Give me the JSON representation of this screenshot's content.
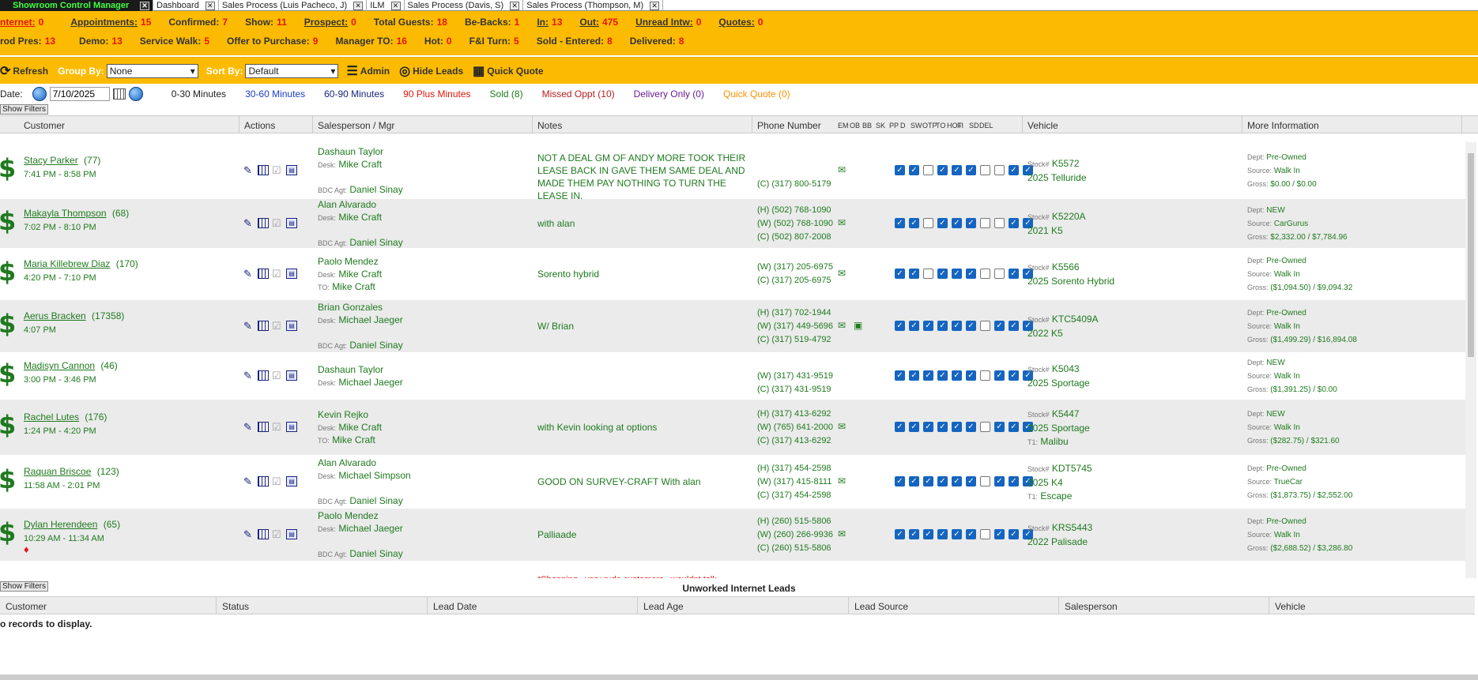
{
  "tabs": [
    {
      "label": "Showroom Control Manager",
      "active": true
    },
    {
      "label": "Dashboard"
    },
    {
      "label": "Sales Process (Luis Pacheco, J)"
    },
    {
      "label": "ILM"
    },
    {
      "label": "Sales Process (Davis, S)"
    },
    {
      "label": "Sales Process (Thompson, M)"
    }
  ],
  "stats_row1": [
    {
      "label": "nternet:",
      "value": "0",
      "underline": true,
      "red": true
    },
    {
      "label": "Appointments:",
      "value": "15",
      "underline": true
    },
    {
      "label": "Confirmed:",
      "value": "7"
    },
    {
      "label": "Show:",
      "value": "11"
    },
    {
      "label": "Prospect:",
      "value": "0",
      "underline": true
    },
    {
      "label": "Total Guests:",
      "value": "18"
    },
    {
      "label": "Be-Backs:",
      "value": "1"
    },
    {
      "label": "In:",
      "value": "13",
      "underline": true
    },
    {
      "label": "Out:",
      "value": "475",
      "underline": true
    },
    {
      "label": "Unread Intw:",
      "value": "0",
      "underline": true
    },
    {
      "label": "Quotes:",
      "value": "0",
      "underline": true
    }
  ],
  "stats_row2": [
    {
      "label": "rod Pres:",
      "value": "13"
    },
    {
      "label": "Demo:",
      "value": "13"
    },
    {
      "label": "Service Walk:",
      "value": "5"
    },
    {
      "label": "Offer to Purchase:",
      "value": "9"
    },
    {
      "label": "Manager TO:",
      "value": "16"
    },
    {
      "label": "Hot:",
      "value": "0"
    },
    {
      "label": "F&I Turn:",
      "value": "5"
    },
    {
      "label": "Sold - Entered:",
      "value": "8"
    },
    {
      "label": "Delivered:",
      "value": "8"
    }
  ],
  "toolbar": {
    "refresh": "Refresh",
    "group_by_label": "Group By:",
    "group_by_value": "None",
    "sort_by_label": "Sort By:",
    "sort_by_value": "Default",
    "admin": "Admin",
    "hide_leads": "Hide Leads",
    "quick_quote": "Quick Quote"
  },
  "daterow": {
    "date_label": "Date:",
    "date_value": "7/10/2025",
    "legend": [
      {
        "label": "0-30 Minutes",
        "color": "#222222"
      },
      {
        "label": "30-60 Minutes",
        "color": "#1a3cc8"
      },
      {
        "label": "60-90 Minutes",
        "color": "#1a237e"
      },
      {
        "label": "90 Plus Minutes",
        "color": "#e8140b"
      },
      {
        "label": "Sold (8)",
        "color": "#1f7a1f"
      },
      {
        "label": "Missed Oppt (10)",
        "color": "#b71c1c"
      },
      {
        "label": "Delivery Only (0)",
        "color": "#6a1b9a"
      },
      {
        "label": "Quick Quote (0)",
        "color": "#ff8f00"
      }
    ]
  },
  "show_filters": "Show Filters",
  "columns": {
    "customer": "Customer",
    "actions": "Actions",
    "salesperson": "Salesperson / Mgr",
    "notes": "Notes",
    "phone": "Phone Number",
    "flags": [
      "EM",
      "OB",
      "BB",
      "SK",
      "PP",
      "D",
      "SW",
      "OTP",
      "TO",
      "HOT",
      "FI",
      "SD",
      "DEL"
    ],
    "vehicle": "Vehicle",
    "more_info": "More Information"
  },
  "rows": [
    {
      "name": "Stacy Parker",
      "count": "(77)",
      "time": "7:41 PM - 8:58 PM",
      "sp": [
        [
          "",
          "Dashaun Taylor"
        ],
        [
          "Desk:",
          "Mike Craft"
        ],
        [
          "",
          ""
        ],
        [
          "BDC Agt:",
          "Daniel Sinay"
        ]
      ],
      "notes": "NOT A DEAL GM OF ANDY MORE TOOK THEIR LEASE BACK IN GAVE THEM SAME DEAL AND MADE THEM PAY NOTHING TO TURN THE LEASE IN.",
      "phones": [
        "",
        "",
        "(C) (317) 800-5179"
      ],
      "email": true,
      "car": false,
      "checks": [
        1,
        1,
        0,
        1,
        1,
        1,
        0,
        0,
        1,
        1
      ],
      "stock": "K5572",
      "vehicle": "2025 Telluride",
      "trade": "",
      "dept": "Pre-Owned",
      "source": "Walk In",
      "gross": "$0.00 / $0.00"
    },
    {
      "name": "Makayla Thompson",
      "count": "(68)",
      "time": "7:02 PM - 8:10 PM",
      "sp": [
        [
          "",
          "Alan Alvarado"
        ],
        [
          "Desk:",
          "Mike Craft"
        ],
        [
          "",
          ""
        ],
        [
          "BDC Agt:",
          "Daniel Sinay"
        ]
      ],
      "notes": "with alan",
      "phones": [
        "(H) (502) 768-1090",
        "(W) (502) 768-1090",
        "(C) (502) 807-2008"
      ],
      "email": true,
      "car": false,
      "checks": [
        1,
        1,
        0,
        1,
        1,
        1,
        0,
        0,
        1,
        1
      ],
      "stock": "K5220A",
      "vehicle": "2021 K5",
      "trade": "",
      "dept": "NEW",
      "source": "CarGurus",
      "gross": "$2,332.00 / $7,784.96"
    },
    {
      "name": "Maria Killebrew Diaz",
      "count": "(170)",
      "time": "4:20 PM - 7:10 PM",
      "sp": [
        [
          "",
          "Paolo Mendez"
        ],
        [
          "Desk:",
          "Mike Craft"
        ],
        [
          "TO:",
          "Mike Craft"
        ]
      ],
      "notes": "Sorento hybrid",
      "phones": [
        "(W) (317) 205-6975",
        "(C) (317) 205-6975"
      ],
      "email": true,
      "car": false,
      "checks": [
        1,
        1,
        0,
        1,
        1,
        1,
        0,
        0,
        1,
        1
      ],
      "stock": "K5566",
      "vehicle": "2025 Sorento Hybrid",
      "trade": "",
      "dept": "Pre-Owned",
      "source": "Walk In",
      "gross": "($1,094.50) / $9,094.32"
    },
    {
      "name": "Aerus Bracken",
      "count": "(17358)",
      "time": "4:07 PM",
      "sp": [
        [
          "",
          "Brian Gonzales"
        ],
        [
          "Desk:",
          "Michael Jaeger"
        ],
        [
          "",
          ""
        ],
        [
          "BDC Agt:",
          "Daniel Sinay"
        ]
      ],
      "notes": "W/ Brian",
      "phones": [
        "(H) (317) 702-1944",
        "(W) (317) 449-5696",
        "(C) (317) 519-4792"
      ],
      "email": true,
      "car": true,
      "checks": [
        1,
        1,
        1,
        1,
        1,
        1,
        0,
        1,
        1,
        1
      ],
      "stock": "KTC5409A",
      "vehicle": "2022 K5",
      "trade": "",
      "dept": "Pre-Owned",
      "source": "Walk In",
      "gross": "($1,499.29) / $16,894.08"
    },
    {
      "name": "Madisyn Cannon",
      "count": "(46)",
      "time": "3:00 PM - 3:46 PM",
      "sp": [
        [
          "",
          "Dashaun Taylor"
        ],
        [
          "Desk:",
          "Michael Jaeger"
        ]
      ],
      "notes": "",
      "phones": [
        "",
        "(W) (317) 431-9519",
        "(C) (317) 431-9519"
      ],
      "email": false,
      "car": false,
      "checks": [
        1,
        1,
        1,
        1,
        1,
        1,
        0,
        1,
        1,
        1
      ],
      "stock": "K5043",
      "vehicle": "2025 Sportage",
      "trade": "",
      "dept": "NEW",
      "source": "Walk In",
      "gross": "($1,391.25) / $0.00"
    },
    {
      "name": "Rachel Lutes",
      "count": "(176)",
      "time": "1:24 PM - 4:20 PM",
      "sp": [
        [
          "",
          "Kevin Rejko"
        ],
        [
          "Desk:",
          "Mike Craft"
        ],
        [
          "TO:",
          "Mike Craft"
        ]
      ],
      "notes": "with Kevin looking at options",
      "phones": [
        "(H) (317) 413-6292",
        "(W) (765) 641-2000",
        "(C) (317) 413-6292"
      ],
      "email": true,
      "car": false,
      "checks": [
        1,
        1,
        1,
        1,
        1,
        1,
        0,
        1,
        1,
        1
      ],
      "stock": "K5447",
      "vehicle": "2025 Sportage",
      "trade": "Malibu",
      "dept": "NEW",
      "source": "Walk In",
      "gross": "($282.75) / $321.60"
    },
    {
      "name": "Raquan Briscoe",
      "count": "(123)",
      "time": "11:58 AM - 2:01 PM",
      "sp": [
        [
          "",
          "Alan Alvarado"
        ],
        [
          "Desk:",
          "Michael Simpson"
        ],
        [
          "",
          ""
        ],
        [
          "BDC Agt:",
          "Daniel Sinay"
        ]
      ],
      "notes": "GOOD ON SURVEY-CRAFT With alan",
      "phones": [
        "(H) (317) 454-2598",
        "(W) (317) 415-8111",
        "(C) (317) 454-2598"
      ],
      "email": true,
      "car": false,
      "checks": [
        1,
        1,
        1,
        1,
        1,
        1,
        0,
        1,
        1,
        1
      ],
      "stock": "KDT5745",
      "vehicle": "2025 K4",
      "trade": "Escape",
      "dept": "Pre-Owned",
      "source": "TrueCar",
      "gross": "($1,873.75) / $2,552.00"
    },
    {
      "name": "Dylan Herendeen",
      "count": "(65)",
      "time": "10:29 AM - 11:34 AM",
      "sp": [
        [
          "",
          "Paolo Mendez"
        ],
        [
          "Desk:",
          "Michael Jaeger"
        ],
        [
          "",
          ""
        ],
        [
          "BDC Agt:",
          "Daniel Sinay"
        ]
      ],
      "notes": "Palliaade",
      "phones": [
        "(H) (260) 515-5806",
        "(W) (260) 266-9936",
        "(C) (260) 515-5806"
      ],
      "email": true,
      "car": false,
      "checks": [
        1,
        1,
        1,
        1,
        1,
        1,
        0,
        1,
        1,
        1
      ],
      "stock": "KRS5443",
      "vehicle": "2022 Palisade",
      "trade": "",
      "dept": "Pre-Owned",
      "source": "Walk In",
      "gross": "($2,688.52) / $3,286.80",
      "hot": true
    }
  ],
  "partial_note": "*Shopping...very rude customers...wouldnt talk",
  "labels": {
    "stock": "Stock#",
    "t1": "T1:",
    "dept": "Dept:",
    "source": "Source:",
    "gross": "Gross:"
  },
  "bottom": {
    "title": "Unworked Internet Leads",
    "columns": [
      "Customer",
      "Status",
      "Lead Date",
      "Lead Age",
      "Lead Source",
      "Salesperson",
      "Vehicle"
    ],
    "empty": "o records to display."
  }
}
